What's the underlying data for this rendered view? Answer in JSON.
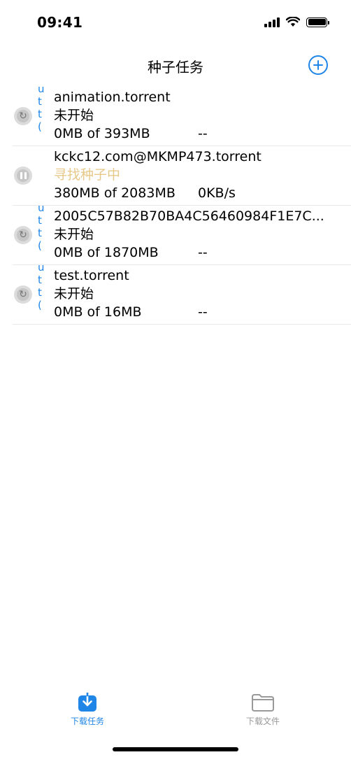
{
  "status_bar": {
    "time": "09:41"
  },
  "nav": {
    "title": "种子任务"
  },
  "edge_chars": [
    "u",
    "t",
    "t",
    "("
  ],
  "tasks": [
    {
      "name": "animation.torrent",
      "status": "未开始",
      "size": "0MB of 393MB",
      "speed": "--",
      "state": "restart"
    },
    {
      "name": "kckc12.com@MKMP473.torrent",
      "status": "寻找种子中",
      "size": "380MB of 2083MB",
      "speed": "0KB/s",
      "state": "pause"
    },
    {
      "name": "2005C57B82B70BA4C56460984F1E7C...",
      "status": "未开始",
      "size": "0MB of 1870MB",
      "speed": "--",
      "state": "restart"
    },
    {
      "name": "test.torrent",
      "status": "未开始",
      "size": "0MB of 16MB",
      "speed": "--",
      "state": "restart"
    }
  ],
  "tab_bar": {
    "tabs": [
      {
        "label": "下载任务",
        "icon": "download-tray-icon",
        "active": true
      },
      {
        "label": "下载文件",
        "icon": "folder-icon",
        "active": false
      }
    ]
  },
  "colors": {
    "accent": "#1f86e8",
    "seeking": "#e6c98a",
    "inactive": "#999999"
  }
}
